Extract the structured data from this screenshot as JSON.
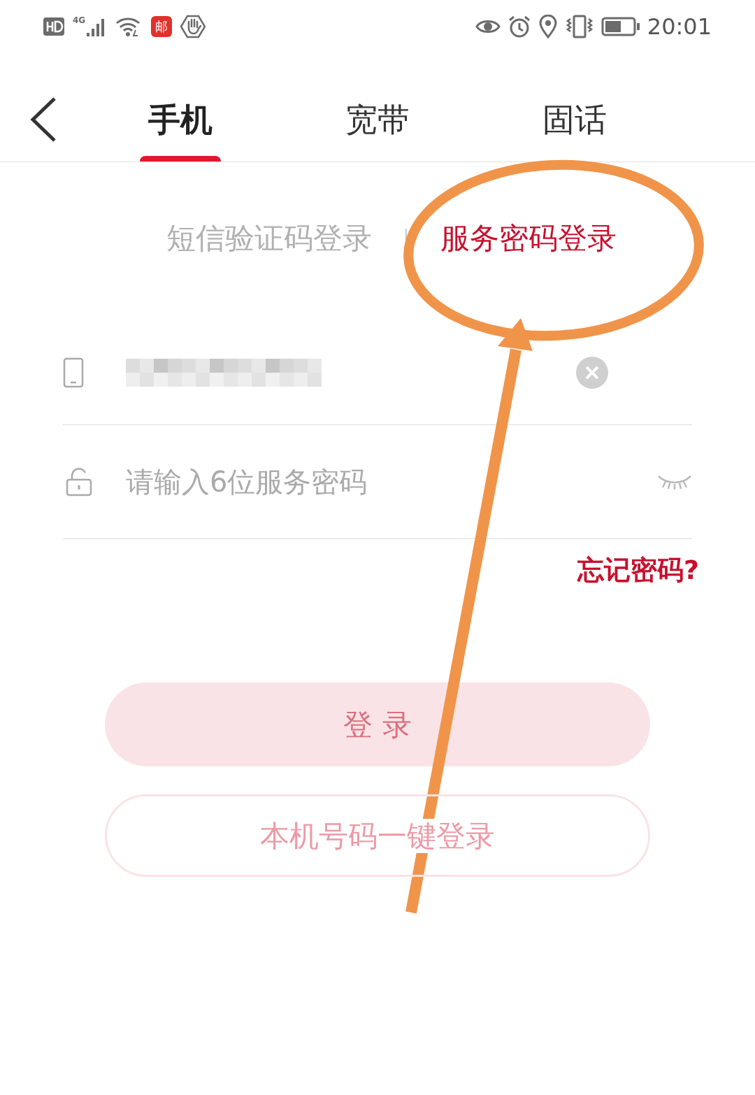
{
  "status_bar": {
    "network": "4G",
    "mail_badge": "邮",
    "time": "20:01"
  },
  "tabs": [
    {
      "label": "手机",
      "selected": true
    },
    {
      "label": "宽带",
      "selected": false
    },
    {
      "label": "固话",
      "selected": false
    }
  ],
  "login_modes": [
    {
      "label": "短信验证码登录",
      "selected": false
    },
    {
      "label": "服务密码登录",
      "selected": true
    }
  ],
  "mode_divider": "|",
  "phone_field": {
    "value_hidden": true
  },
  "password_field": {
    "placeholder": "请输入6位服务密码"
  },
  "forgot_link": "忘记密码?",
  "login_button": {
    "label": "登 录",
    "disabled": true
  },
  "one_key_button": {
    "label": "本机号码一键登录",
    "disabled": true
  }
}
